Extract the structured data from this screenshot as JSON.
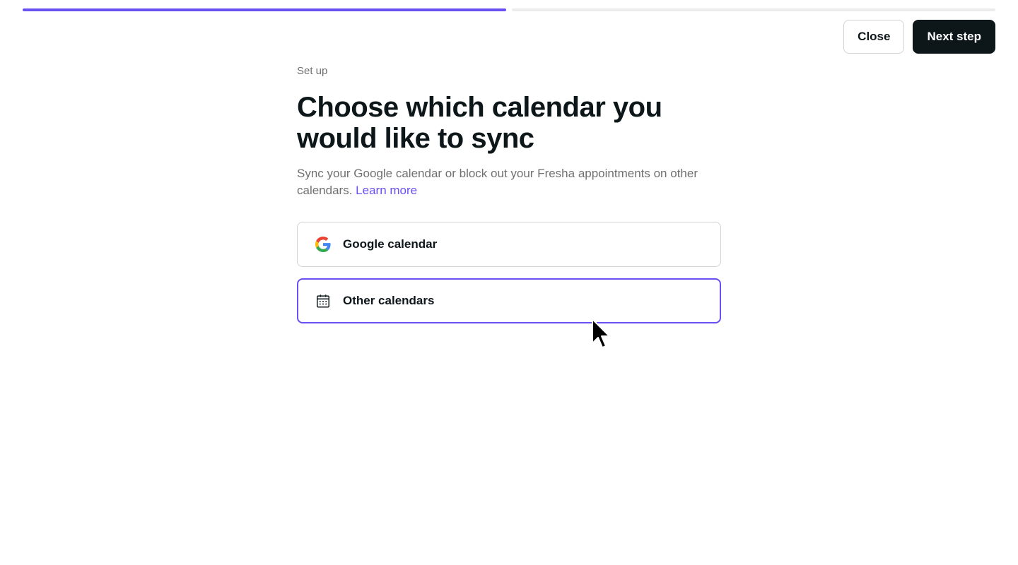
{
  "progress": {
    "completed_steps": 1,
    "total_steps": 2,
    "accent": "#6950f3"
  },
  "header": {
    "close_label": "Close",
    "next_label": "Next step"
  },
  "main": {
    "eyebrow": "Set up",
    "title": "Choose which calendar you would like to sync",
    "description": "Sync your Google calendar or block out your Fresha appointments on other calendars.",
    "learn_more_label": "Learn more"
  },
  "options": [
    {
      "label": "Google calendar",
      "icon": "google-icon",
      "selected": false
    },
    {
      "label": "Other calendars",
      "icon": "calendar-icon",
      "selected": true
    }
  ]
}
